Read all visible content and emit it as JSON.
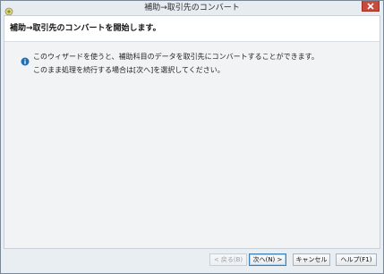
{
  "window": {
    "title": "補助→取引先のコンバート"
  },
  "header": {
    "title": "補助→取引先のコンバートを開始します。"
  },
  "message": {
    "line1": "このウィザードを使うと、補助科目のデータを取引先にコンバートすることができます。",
    "line2": "このまま処理を続行する場合は[次へ]を選択してください。"
  },
  "buttons": {
    "back": "< 戻る(B)",
    "next": "次へ(N) >",
    "cancel": "キャンセル",
    "help": "ヘルプ(F1)"
  },
  "colors": {
    "info_icon": "#1f6fb2",
    "close_button": "#c94a3d",
    "default_button_border": "#3c7fb1"
  },
  "icons": {
    "app": "app-icon",
    "close": "close-icon",
    "info": "info-icon"
  }
}
